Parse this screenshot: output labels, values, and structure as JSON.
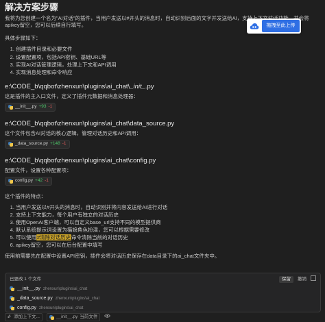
{
  "title": "解决方案步骤",
  "intro": "我将为您创建一个名为\"AI对话\"的插件，当用户发送以#开头的消息时，自动识别后面的文字并发送给AI，支持上下文对话功能，并会将apikey留空，您可以后续自行填写。",
  "steps_label": "具体步骤如下：",
  "steps": [
    "创建插件目录和必要文件",
    "设置配置项，包括API密钥、基础URL等",
    "实现AI对话管理逻辑，处理上下文和API调用",
    "实现消息处理和命令响应"
  ],
  "files": [
    {
      "path_prefix": "e:\\CODE_b\\qqbot\\zhenxun\\plugins\\ai_chat\\",
      "path_emph": "_init_",
      "path_suffix": ".py",
      "desc": "这是插件的主入口文件，定义了插件元数据和消息处理器：",
      "chip": "__init__.py",
      "added": "+93",
      "removed": "-1"
    },
    {
      "path_prefix": "e:\\CODE_b\\qqbot\\zhenxun\\plugins\\ai_chat\\data_source.py",
      "path_emph": "",
      "path_suffix": "",
      "desc": "这个文件包含AI对话的核心逻辑，管理对话历史和API调用：",
      "chip": "_data_source.py",
      "added": "+148",
      "removed": "-1"
    },
    {
      "path_prefix": "e:\\CODE_b\\qqbot\\zhenxun\\plugins\\ai_chat\\config.py",
      "path_emph": "",
      "path_suffix": "",
      "desc": "配置文件，设置各种配置项：",
      "chip": "config.py",
      "added": "+42",
      "removed": "-1"
    }
  ],
  "features_label": "这个插件的特点：",
  "features": [
    "当用户发送以#开头的消息时，自动识别并将内容发送给AI进行对话",
    "支持上下文能力，每个用户有独立的对话历史",
    "使用OpenAI客户端，可以自定义base_url支持不同的模型提供商",
    "默认系统提示词设置为猫娘角色扮演，您可以根据需要修改"
  ],
  "feature5": {
    "before": "可以使用",
    "highlight": "#清除对话历史",
    "after": "命令清除当前的对话历史"
  },
  "feature6": "apikey留空，您可以在后台配置中填写",
  "closing": "使用前需要先在配置中设置API密钥，插件会将对话历史保存在data目录下的ai_chat文件夹中。",
  "upload": {
    "button": "拖拽至此上传"
  },
  "panel": {
    "header": "已更改 1 个文件",
    "keep": "保留",
    "undo": "撤销",
    "rows": [
      {
        "name": "__init__.py",
        "path": "zhenxun\\plugins\\ai_chat"
      },
      {
        "name": "_data_source.py",
        "path": "zhenxun\\plugins\\ai_chat"
      },
      {
        "name": "config.py",
        "path": "zhenxun\\plugins\\ai_chat"
      }
    ]
  },
  "bottom": {
    "add_context": "添加上下文...",
    "current_file": "__init__.py",
    "current_tag": "当前文件"
  },
  "colors": {
    "added": "#4ec96b",
    "removed": "#e05b5b",
    "accent": "#2f6fe4",
    "highlight": "#c9a227"
  }
}
